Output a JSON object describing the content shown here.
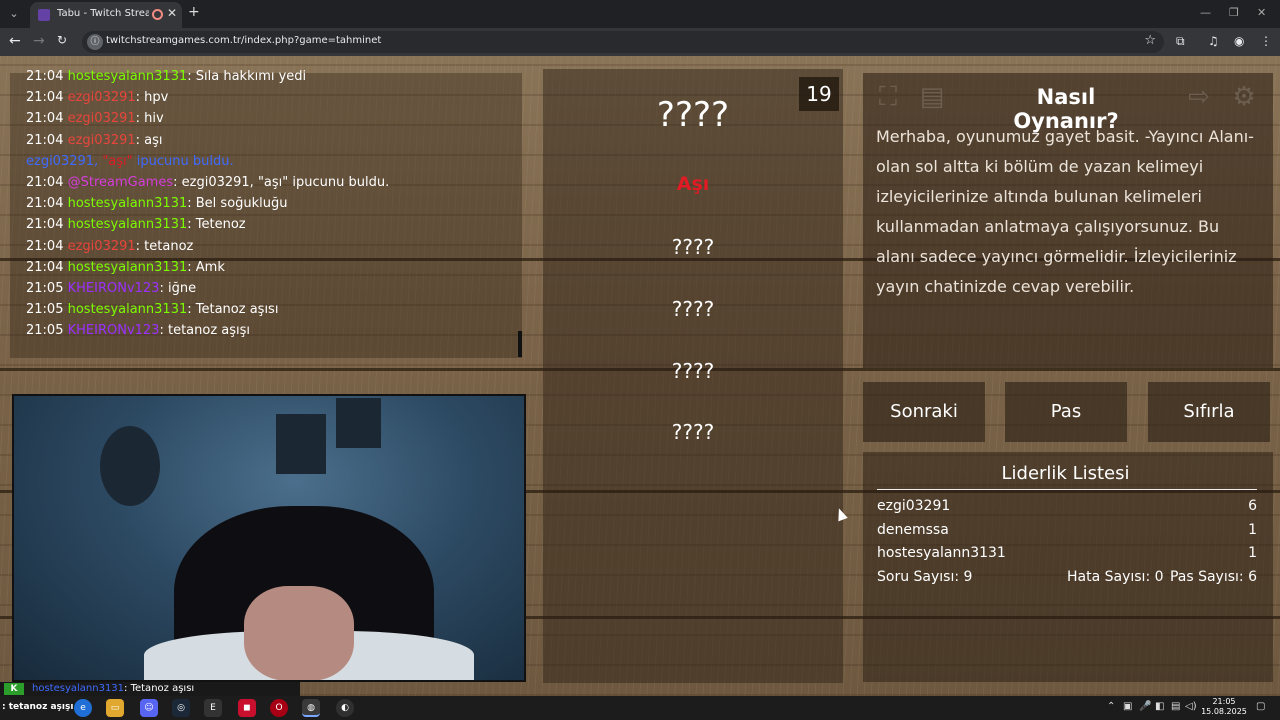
{
  "browser": {
    "tab_title": "Tabu - Twitch Stream Games",
    "url": "twitchstreamgames.com.tr/index.php?game=tahminet",
    "site_icon": "info-icon"
  },
  "chat": {
    "lines": [
      {
        "time": "21:04",
        "user": "hostesyalann3131",
        "user_color": "#7CFC00",
        "msg": ": Sıla hakkımı yedi"
      },
      {
        "time": "21:04",
        "user": "ezgi03291",
        "user_color": "#E8453C",
        "msg": ": hpv"
      },
      {
        "time": "21:04",
        "user": "ezgi03291",
        "user_color": "#E8453C",
        "msg": ": hiv"
      },
      {
        "time": "21:04",
        "user": "ezgi03291",
        "user_color": "#E8453C",
        "msg": ": aşı"
      },
      {
        "time": "",
        "user": "ezgi03291,",
        "user_color": "#3E6BFF",
        "msg": " \"aşı\" ipucunu buldu.",
        "msg_color": "#3E6BFF",
        "highlight": "\"aşı\""
      },
      {
        "time": "21:04",
        "user": "@StreamGames",
        "user_color": "#D63DDC",
        "msg": ": ezgi03291, \"aşı\" ipucunu buldu."
      },
      {
        "time": "21:04",
        "user": "hostesyalann3131",
        "user_color": "#7CFC00",
        "msg": ": Bel soğukluğu"
      },
      {
        "time": "21:04",
        "user": "hostesyalann3131",
        "user_color": "#7CFC00",
        "msg": ": Tetenoz"
      },
      {
        "time": "21:04",
        "user": "ezgi03291",
        "user_color": "#E8453C",
        "msg": ": tetanoz"
      },
      {
        "time": "21:04",
        "user": "hostesyalann3131",
        "user_color": "#7CFC00",
        "msg": ": Amk"
      },
      {
        "time": "21:05",
        "user": "KHEIRONv123",
        "user_color": "#9B30FF",
        "msg": ": iğne"
      },
      {
        "time": "21:05",
        "user": "hostesyalann3131",
        "user_color": "#7CFC00",
        "msg": ": Tetanoz aşısı"
      },
      {
        "time": "21:05",
        "user": "KHEIRONv123",
        "user_color": "#9B30FF",
        "msg": ": tetanoz aşışı"
      }
    ]
  },
  "game": {
    "counter": "19",
    "main_word": "????",
    "hints": [
      "Aşı",
      "????",
      "????",
      "????",
      "????"
    ],
    "hint_revealed_color": "#E01B24"
  },
  "info": {
    "title": "Nasıl Oynanır?",
    "text": "Merhaba, oyunumuz gayet basit. -Yayıncı Alanı- olan sol altta ki bölüm de yazan kelimeyi izleyicilerinize altında bulunan kelimeleri kullanmadan anlatmaya çalışıyorsunuz. Bu alanı sadece yayıncı görmelidir. İzleyicileriniz yayın chatinizde cevap verebilir.",
    "icons": [
      "fullscreen-icon",
      "document-icon",
      "exit-icon",
      "gear-icon"
    ]
  },
  "buttons": {
    "next": "Sonraki",
    "pass": "Pas",
    "reset": "Sıfırla"
  },
  "leaderboard": {
    "title": "Liderlik Listesi",
    "rows": [
      {
        "name": "ezgi03291",
        "score": "6"
      },
      {
        "name": "denemssa",
        "score": "1"
      },
      {
        "name": "hostesyalann3131",
        "score": "1"
      }
    ],
    "questions": "Soru Sayısı: 9",
    "errors": "Hata Sayısı: 0",
    "passes": "Pas Sayısı: 6"
  },
  "overlay": {
    "badge": "K",
    "user": "hostesyalann3131",
    "msg": ": Tetanoz aşısı"
  },
  "taskbar": {
    "left_text": ": tetanoz aşışı",
    "time": "21:05",
    "date": "15.08.2025"
  }
}
